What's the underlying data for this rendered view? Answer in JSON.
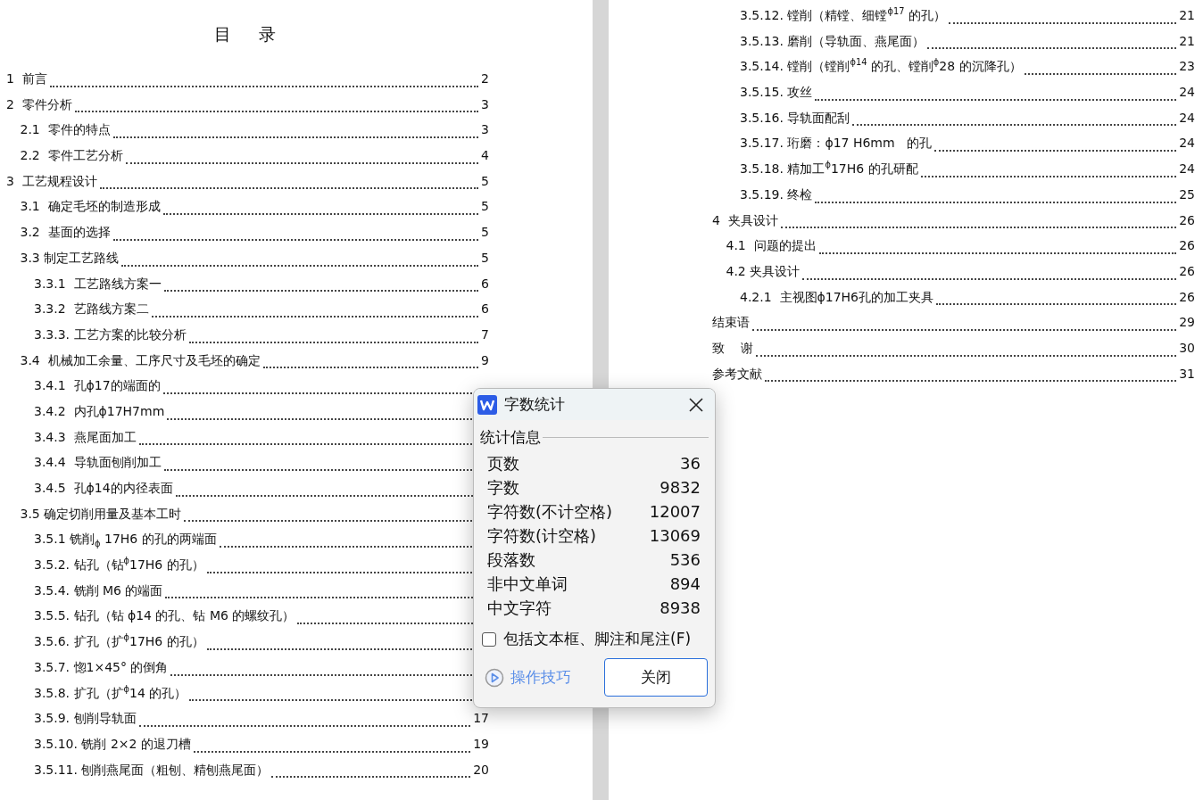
{
  "pages": [
    {
      "title": "目  录",
      "entries": [
        {
          "label": "1  前言",
          "page": "2"
        },
        {
          "label": "2  零件分析",
          "page": "3",
          "children": [
            {
              "label": "2.1  零件的特点",
              "page": "3"
            },
            {
              "label": "2.2  零件工艺分析",
              "page": "4"
            }
          ]
        },
        {
          "label": "3  工艺规程设计",
          "page": "5",
          "children": [
            {
              "label": "3.1  确定毛坯的制造形成",
              "page": "5"
            },
            {
              "label": "3.2  基面的选择",
              "page": "5"
            },
            {
              "label": "3.3 制定工艺路线",
              "page": "5",
              "children": [
                {
                  "label": "3.3.1  工艺路线方案一",
                  "page": "6"
                },
                {
                  "label": "3.3.2  艺路线方案二",
                  "page": "6"
                },
                {
                  "label": "3.3.3. 工艺方案的比较分析",
                  "page": "7"
                }
              ]
            },
            {
              "label": "3.4  机械加工余量、工序尺寸及毛坯的确定",
              "page": "9",
              "children": [
                {
                  "label": "3.4.1  孔ϕ17的端面的"
                },
                {
                  "label": "3.4.2  内孔ϕ17H7mm"
                },
                {
                  "label": "3.4.3  燕尾面加工"
                },
                {
                  "label": "3.4.4  导轨面刨削加工"
                },
                {
                  "label": "3.4.5  孔ϕ14的内径表面"
                }
              ]
            },
            {
              "label": "3.5 确定切削用量及基本工时",
              "children": [
                {
                  "label": "3.5.1 铣削$_{ϕ}$ 17H6 的孔的两端面"
                },
                {
                  "label": "3.5.2. 钻孔（钻$^{ϕ}$17H6 的孔）"
                },
                {
                  "label": "3.5.4. 铣削 M6 的端面"
                },
                {
                  "label": "3.5.5. 钻孔（钻 ϕ14 的孔、钻 M6 的螺纹孔）"
                },
                {
                  "label": "3.5.6. 扩孔（扩$^{ϕ}$17H6 的孔）"
                },
                {
                  "label": "3.5.7. 惚1×45° 的倒角"
                },
                {
                  "label": "3.5.8. 扩孔（扩$^{ϕ}$14 的孔）"
                },
                {
                  "label": "3.5.9. 刨削导轨面",
                  "page": "17"
                },
                {
                  "label": "3.5.10. 铣削 2×2 的退刀槽",
                  "page": "19"
                },
                {
                  "label": "3.5.11. 刨削燕尾面（粗刨、精刨燕尾面）",
                  "page": "20"
                }
              ]
            }
          ]
        }
      ]
    },
    {
      "entries": [
        {
          "children": [
            {
              "children": [
                {
                  "label": "3.5.12. 镗削（精镗、细镗$^{ϕ17}$ 的孔）",
                  "page": "21"
                },
                {
                  "label": "3.5.13. 磨削（导轨面、燕尾面）",
                  "page": "21"
                },
                {
                  "label": "3.5.14. 镗削（镗削$^{ϕ14}$ 的孔、镗削$^{ϕ}$28 的沉降孔）",
                  "page": "23"
                },
                {
                  "label": "3.5.15. 攻丝",
                  "page": "24"
                },
                {
                  "label": "3.5.16. 导轨面配刮",
                  "page": "24"
                },
                {
                  "label": "3.5.17. 珩磨：ϕ17 H6mm   的孔",
                  "page": "24"
                },
                {
                  "label": "3.5.18. 精加工$^{ϕ}$17H6 的孔研配",
                  "page": "24"
                },
                {
                  "label": "3.5.19. 终检",
                  "page": "25"
                }
              ]
            }
          ]
        },
        {
          "label": "4  夹具设计",
          "page": "26",
          "children": [
            {
              "label": "4.1  问题的提出",
              "page": "26"
            },
            {
              "label": "4.2 夹具设计",
              "page": "26",
              "children": [
                {
                  "label": "4.2.1  主视图ϕ17H6孔的加工夹具",
                  "page": "26"
                }
              ]
            }
          ]
        },
        {
          "label": "结束语",
          "page": "29"
        },
        {
          "label": "致    谢",
          "page": "30"
        },
        {
          "label": "参考文献",
          "page": "31"
        }
      ]
    }
  ],
  "dialog": {
    "title": "字数统计",
    "section": "统计信息",
    "stats": [
      {
        "label": "页数",
        "value": "36"
      },
      {
        "label": "字数",
        "value": "9832"
      },
      {
        "label": "字符数(不计空格)",
        "value": "12007"
      },
      {
        "label": "字符数(计空格)",
        "value": "13069"
      },
      {
        "label": "段落数",
        "value": "536"
      },
      {
        "label": "非中文单词",
        "value": "894"
      },
      {
        "label": "中文字符",
        "value": "8938"
      }
    ],
    "checkbox": {
      "label": "包括文本框、脚注和尾注(F)",
      "checked": false
    },
    "tips": "操作技巧",
    "close_button": "关闭"
  }
}
